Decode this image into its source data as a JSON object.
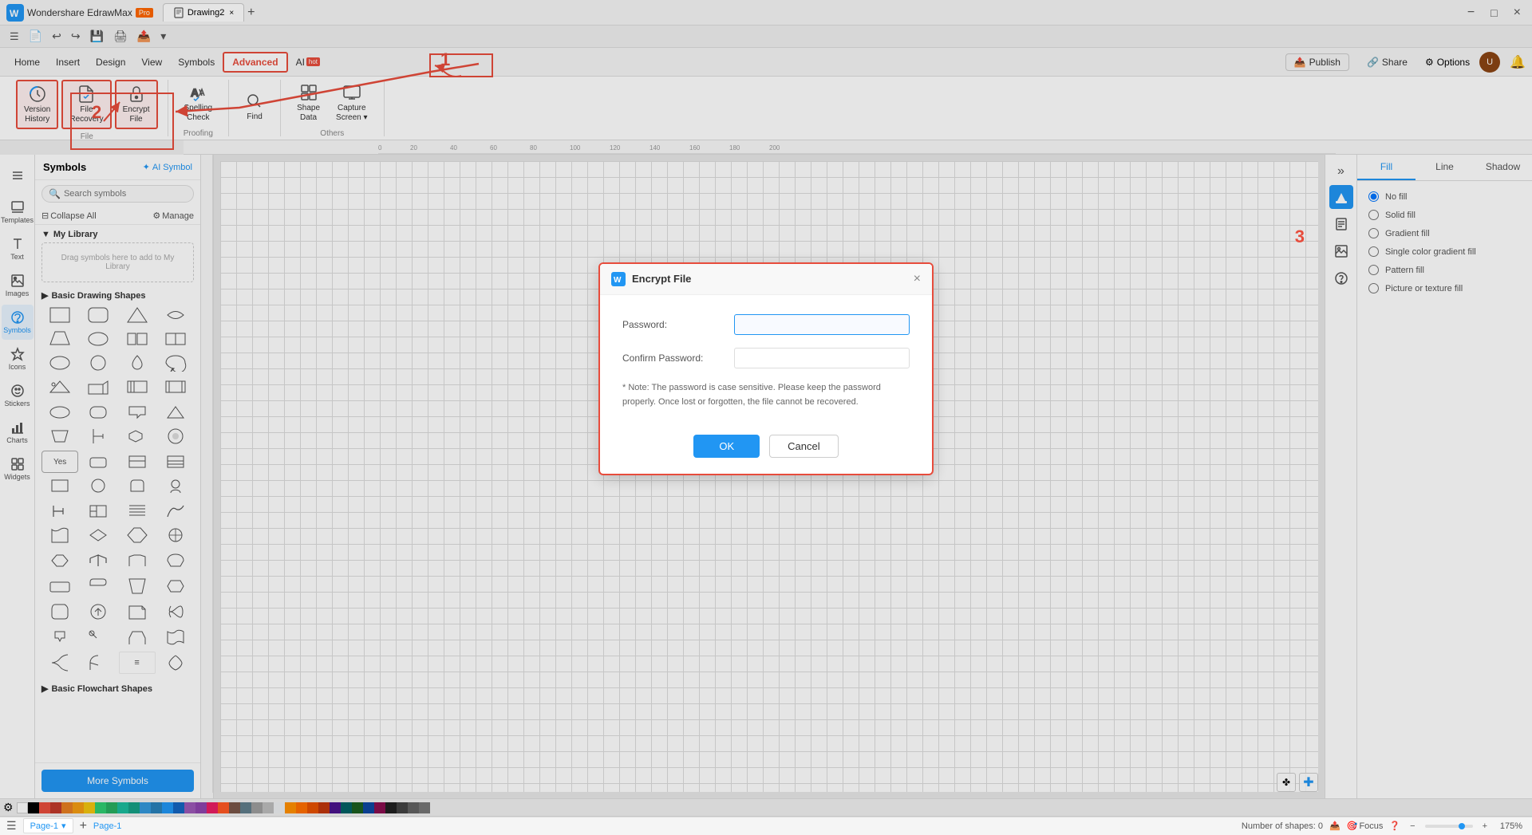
{
  "app": {
    "name": "Wondershare EdrawMax",
    "badge": "Pro",
    "file_name": "Drawing2",
    "tab_close": "×",
    "tab_add": "+"
  },
  "window_controls": {
    "minimize": "−",
    "maximize": "□",
    "close": "×"
  },
  "menubar": {
    "items": [
      {
        "label": "Home",
        "active": false
      },
      {
        "label": "Insert",
        "active": false
      },
      {
        "label": "Design",
        "active": false
      },
      {
        "label": "View",
        "active": false
      },
      {
        "label": "Symbols",
        "active": false
      },
      {
        "label": "Advanced",
        "active": true
      },
      {
        "label": "AI",
        "active": false,
        "badge": "hot"
      }
    ],
    "publish": "Publish",
    "share": "Share",
    "options": "Options"
  },
  "ribbon": {
    "groups": [
      {
        "label": "File",
        "buttons": [
          {
            "id": "version-history",
            "label": "Version\nHistory",
            "highlighted": true
          },
          {
            "id": "file-recovery",
            "label": "File\nRecovery",
            "highlighted": true
          },
          {
            "id": "encrypt-file",
            "label": "Encrypt\nFile",
            "highlighted": true
          }
        ]
      },
      {
        "label": "Proofing",
        "buttons": [
          {
            "id": "spelling-check",
            "label": "Spelling\nCheck",
            "highlighted": false
          }
        ]
      },
      {
        "label": "",
        "buttons": [
          {
            "id": "find",
            "label": "Find",
            "highlighted": false
          }
        ]
      },
      {
        "label": "Others",
        "buttons": [
          {
            "id": "shape-data",
            "label": "Shape\nData",
            "highlighted": false
          },
          {
            "id": "capture-screen",
            "label": "Capture\nScreen",
            "highlighted": false
          }
        ]
      }
    ]
  },
  "symbols_panel": {
    "title": "Symbols",
    "ai_button": "AI Symbol",
    "search_placeholder": "Search symbols",
    "collapse_all": "Collapse All",
    "manage": "Manage",
    "my_library_label": "My Library",
    "drag_hint": "Drag symbols here to add to My Library",
    "basic_drawing": "Basic Drawing Shapes",
    "basic_flowchart": "Basic Flowchart Shapes",
    "more_symbols": "More Symbols"
  },
  "right_panel": {
    "tabs": [
      "Fill",
      "Line",
      "Shadow"
    ],
    "active_tab": "Fill",
    "fill_options": [
      "No fill",
      "Solid fill",
      "Gradient fill",
      "Single color gradient fill",
      "Pattern fill",
      "Picture or texture fill"
    ]
  },
  "dialog": {
    "title": "Encrypt File",
    "password_label": "Password:",
    "confirm_password_label": "Confirm Password:",
    "note": "* Note: The password is case sensitive. Please keep the password properly. Once lost or forgotten, the file cannot be recovered.",
    "ok_button": "OK",
    "cancel_button": "Cancel",
    "close": "×"
  },
  "bottombar": {
    "page_label": "Page-1",
    "page_tab": "Page-1",
    "add_page": "+",
    "shapes_count": "Number of shapes: 0",
    "focus": "Focus",
    "zoom": "175%"
  },
  "annotations": {
    "num1": "1",
    "num2": "2",
    "num3": "3"
  },
  "colors": {
    "accent": "#2196f3",
    "highlight": "#e74c3c",
    "badge_bg": "#ff6600"
  }
}
